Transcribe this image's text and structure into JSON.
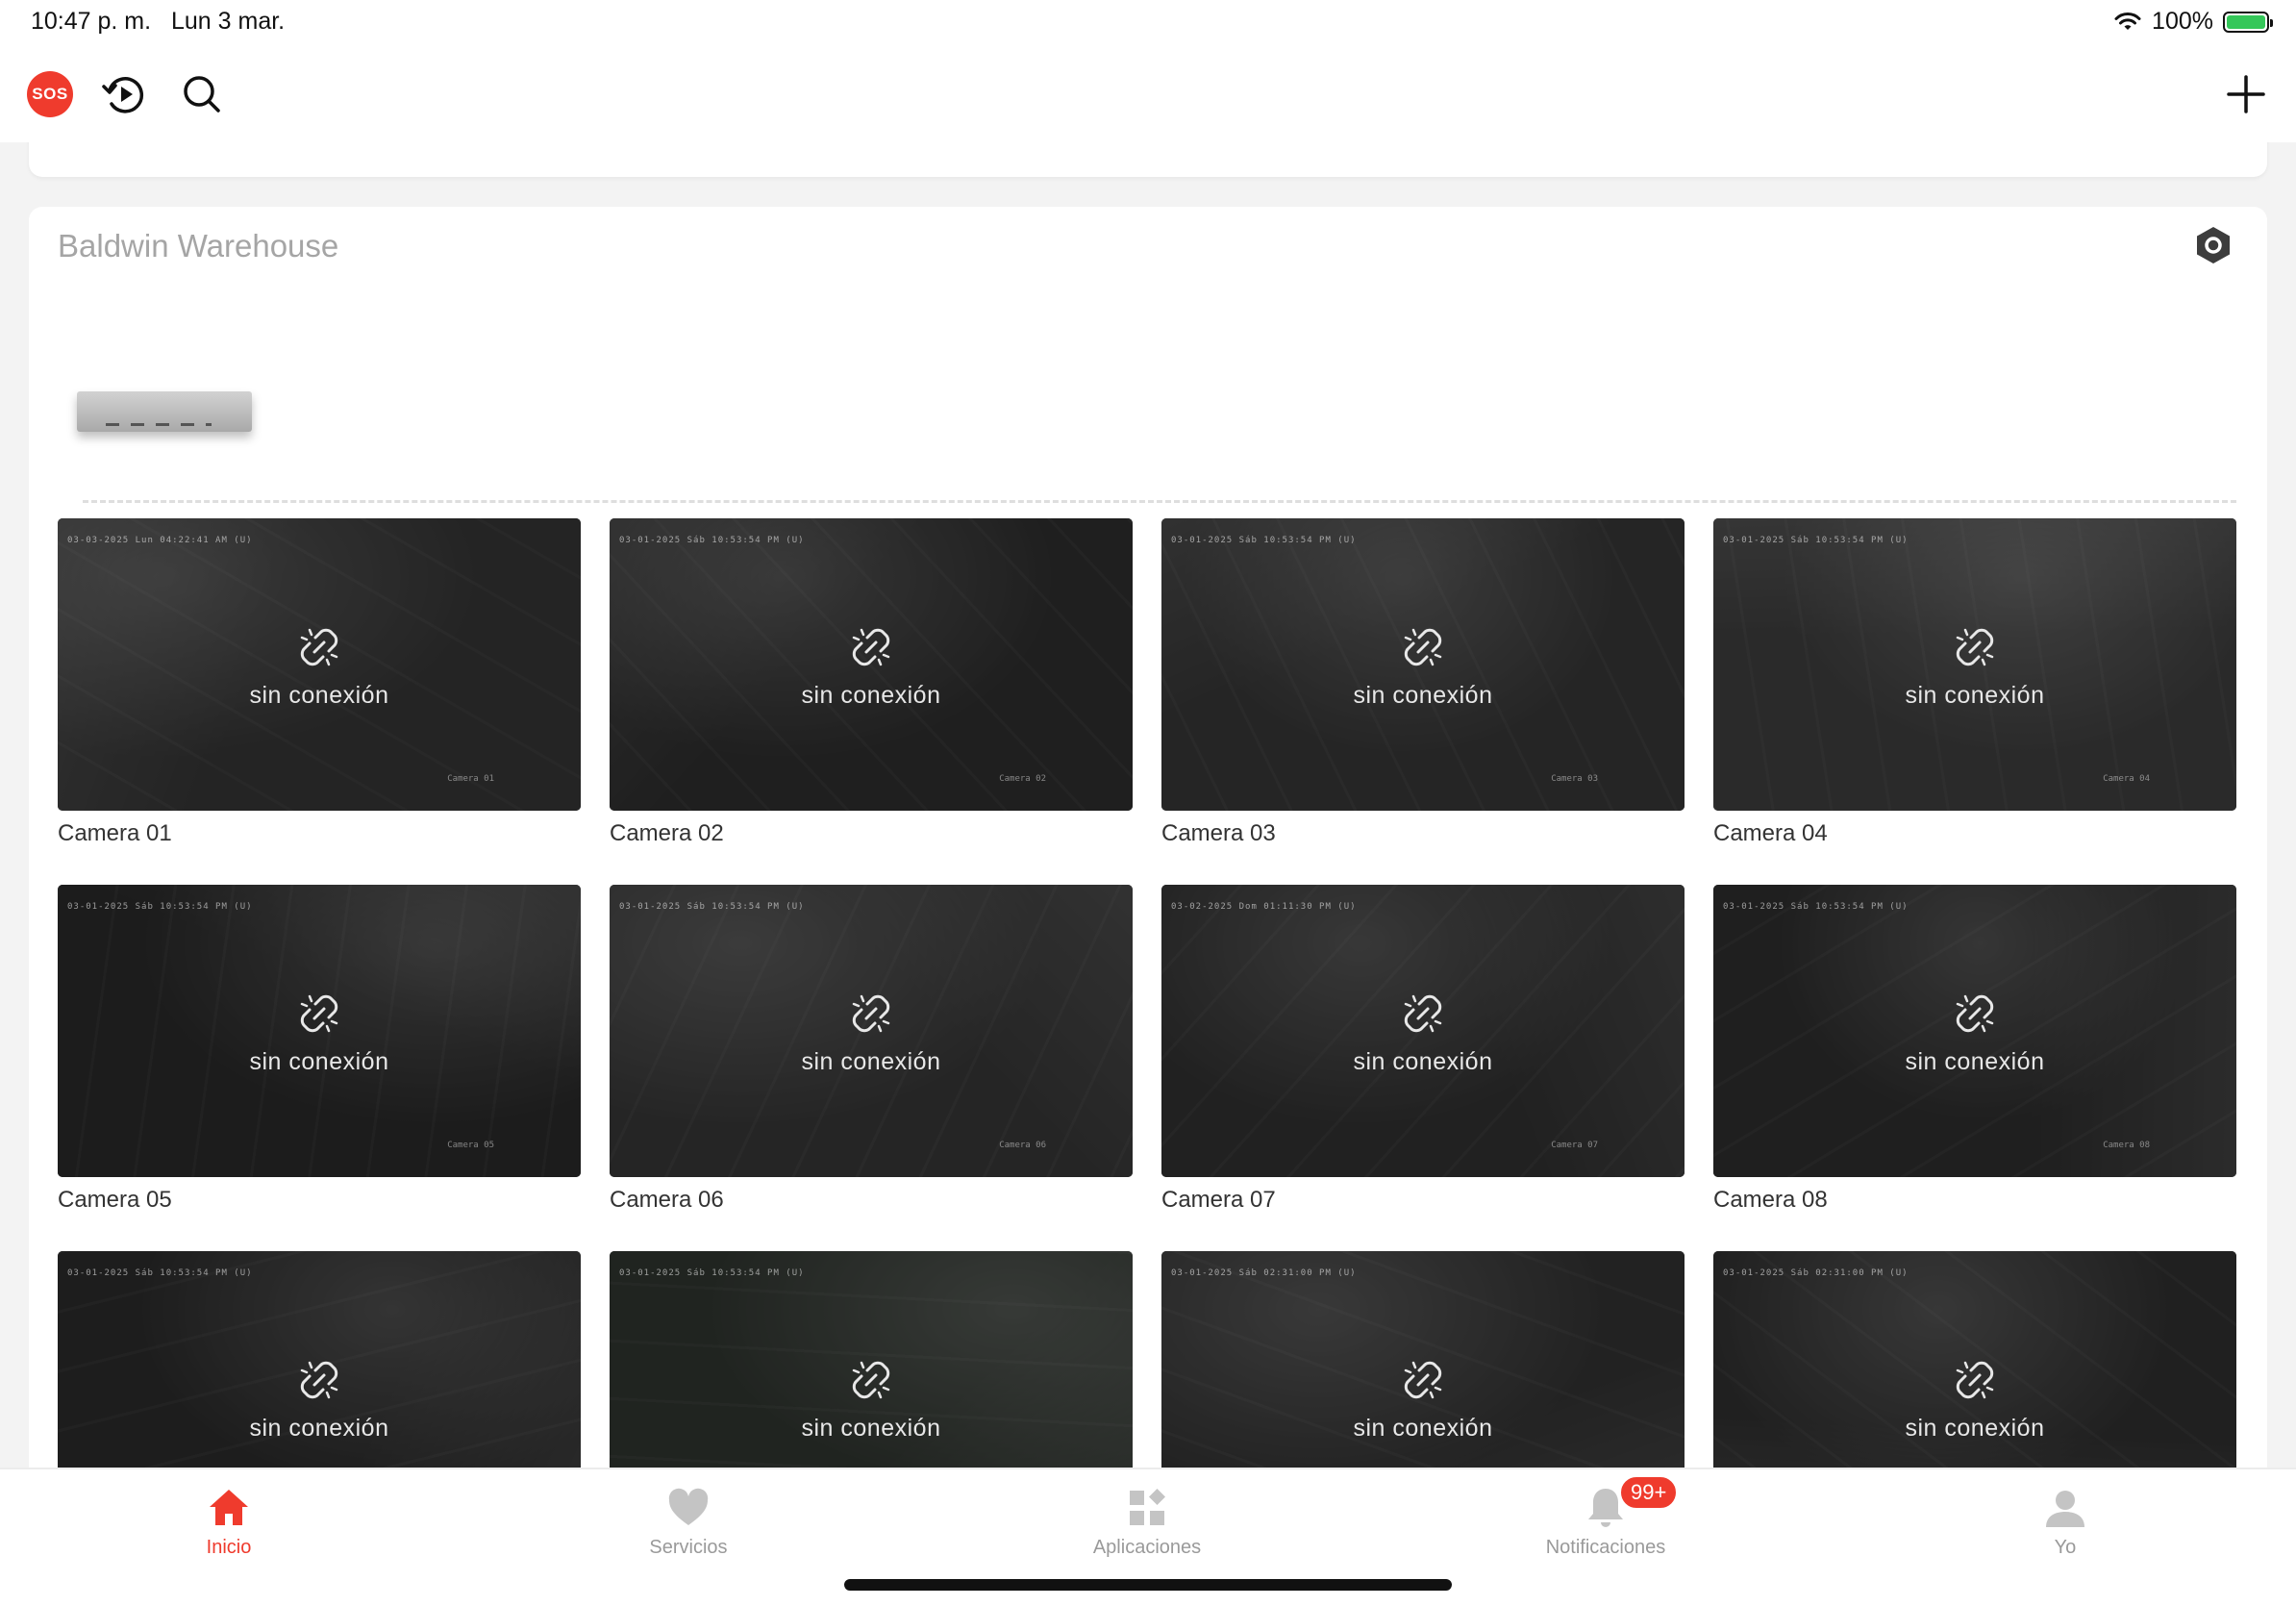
{
  "status_bar": {
    "time": "10:47 p. m.",
    "date": "Lun 3 mar.",
    "battery": "100%"
  },
  "toolbar": {
    "sos_label": "SOS"
  },
  "site": {
    "title": "Baldwin Warehouse"
  },
  "cameras": [
    {
      "name": "Camera 01",
      "status": "sin conexión",
      "timestamp": "03-03-2025 Lun 04:22:41 AM (U)",
      "watermark": "Camera 01"
    },
    {
      "name": "Camera 02",
      "status": "sin conexión",
      "timestamp": "03-01-2025 Sáb 10:53:54 PM (U)",
      "watermark": "Camera 02"
    },
    {
      "name": "Camera 03",
      "status": "sin conexión",
      "timestamp": "03-01-2025 Sáb 10:53:54 PM (U)",
      "watermark": "Camera 03"
    },
    {
      "name": "Camera 04",
      "status": "sin conexión",
      "timestamp": "03-01-2025 Sáb 10:53:54 PM (U)",
      "watermark": "Camera 04"
    },
    {
      "name": "Camera 05",
      "status": "sin conexión",
      "timestamp": "03-01-2025 Sáb 10:53:54 PM (U)",
      "watermark": "Camera 05"
    },
    {
      "name": "Camera 06",
      "status": "sin conexión",
      "timestamp": "03-01-2025 Sáb 10:53:54 PM (U)",
      "watermark": "Camera 06"
    },
    {
      "name": "Camera 07",
      "status": "sin conexión",
      "timestamp": "03-02-2025 Dom 01:11:30 PM (U)",
      "watermark": "Camera 07"
    },
    {
      "name": "Camera 08",
      "status": "sin conexión",
      "timestamp": "03-01-2025 Sáb 10:53:54 PM (U)",
      "watermark": "Camera 08"
    },
    {
      "name": "",
      "status": "sin conexión",
      "timestamp": "03-01-2025 Sáb 10:53:54 PM (U)",
      "watermark": ""
    },
    {
      "name": "",
      "status": "sin conexión",
      "timestamp": "03-01-2025 Sáb 10:53:54 PM (U)",
      "watermark": ""
    },
    {
      "name": "",
      "status": "sin conexión",
      "timestamp": "03-01-2025 Sáb 02:31:00 PM (U)",
      "watermark": ""
    },
    {
      "name": "",
      "status": "sin conexión",
      "timestamp": "03-01-2025 Sáb 02:31:00 PM (U)",
      "watermark": ""
    }
  ],
  "tabs": [
    {
      "label": "Inicio",
      "active": true
    },
    {
      "label": "Servicios",
      "active": false
    },
    {
      "label": "Aplicaciones",
      "active": false
    },
    {
      "label": "Notificaciones",
      "active": false,
      "badge": "99+"
    },
    {
      "label": "Yo",
      "active": false
    }
  ],
  "colors": {
    "accent": "#ef3b2d",
    "inactive": "#9a9a9a",
    "battery": "#34c759"
  }
}
